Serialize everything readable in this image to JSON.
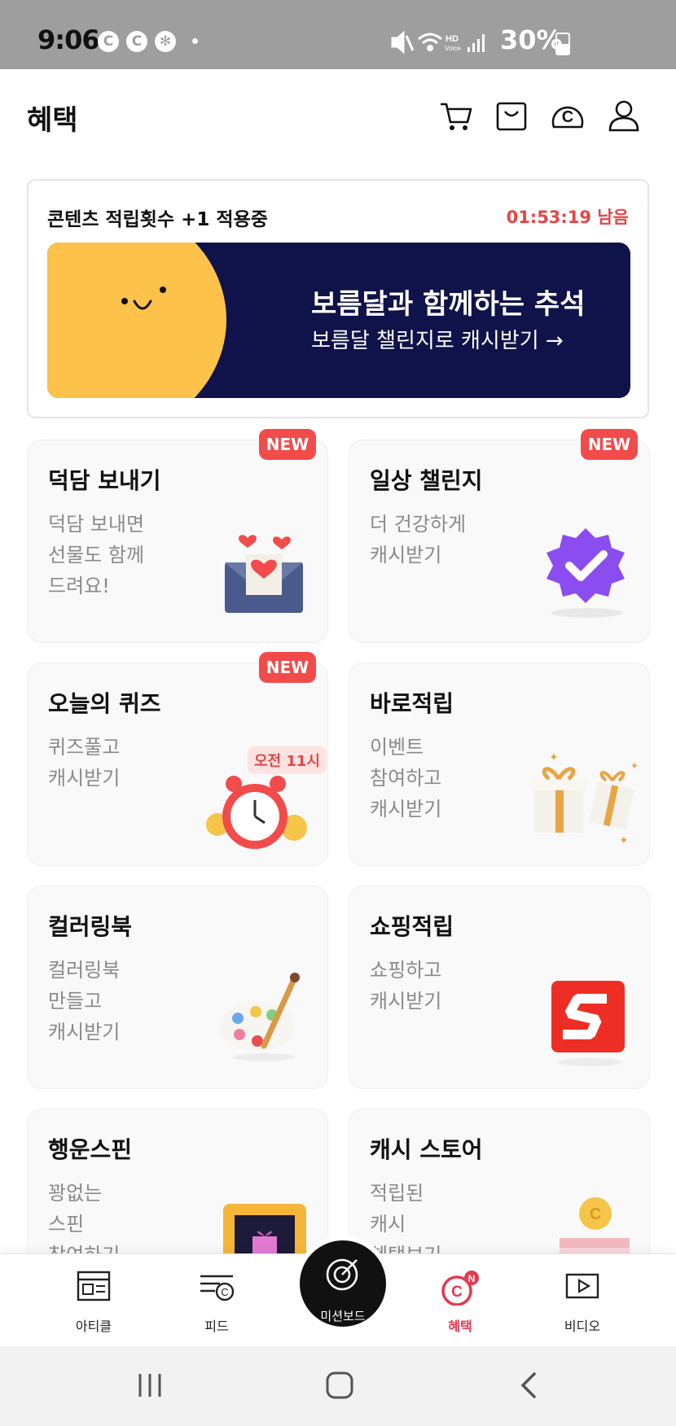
{
  "status_bar": {
    "time": "9:06",
    "icons": [
      "c-icon",
      "c-icon",
      "fan-icon",
      "dot"
    ],
    "right": "30%",
    "right_icons": [
      "mute-icon",
      "wifi-icon",
      "hd-voice-icon",
      "signal-icon",
      "battery-icon"
    ]
  },
  "header": {
    "title": "혜택",
    "icons": [
      "cart-icon",
      "shopping-bag-icon",
      "cash-icon",
      "profile-icon"
    ]
  },
  "promo": {
    "label": "콘텐츠 적립횟수 +1 적용중",
    "timer": "01:53:19 남음",
    "banner_title": "보름달과 함께하는 추석",
    "banner_subtitle": "보름달 챌린지로 캐시받기 →"
  },
  "tiles": [
    {
      "title": "덕담 보내기",
      "desc": "덕담 보내면\n선물도 함께\n드려요!",
      "badge": "NEW",
      "icon": "heart-envelope-icon"
    },
    {
      "title": "일상 챌린지",
      "desc": "더 건강하게\n캐시받기",
      "badge": "NEW",
      "icon": "verified-badge-icon"
    },
    {
      "title": "오늘의 퀴즈",
      "desc": "퀴즈풀고\n캐시받기",
      "badge": "NEW",
      "tag": "오전 11시",
      "icon": "alarm-clock-icon"
    },
    {
      "title": "바로적립",
      "desc": "이벤트\n참여하고\n캐시받기",
      "icon": "gift-boxes-icon"
    },
    {
      "title": "컬러링북",
      "desc": "컬러링북\n만들고\n캐시받기",
      "icon": "paint-palette-icon"
    },
    {
      "title": "쇼핑적립",
      "desc": "쇼핑하고\n캐시받기",
      "icon": "shopping-s-icon"
    },
    {
      "title": "행운스핀",
      "desc": "꽝없는\n스핀\n참여하기",
      "icon": "spin-frame-icon"
    },
    {
      "title": "캐시 스토어",
      "desc": "적립된\n캐시\n혜택보기",
      "icon": "coin-box-icon"
    }
  ],
  "bottom_nav": {
    "items": [
      {
        "label": "아티클",
        "icon": "article-icon"
      },
      {
        "label": "피드",
        "icon": "feed-icon"
      },
      {
        "label": "미션보드",
        "icon": "target-icon"
      },
      {
        "label": "혜택",
        "icon": "cash-benefit-icon",
        "badge": "N",
        "active": true
      },
      {
        "label": "비디오",
        "icon": "video-icon"
      }
    ],
    "active_color": "#e53950"
  },
  "system_nav": [
    "recent-apps-icon",
    "home-icon",
    "back-icon"
  ]
}
